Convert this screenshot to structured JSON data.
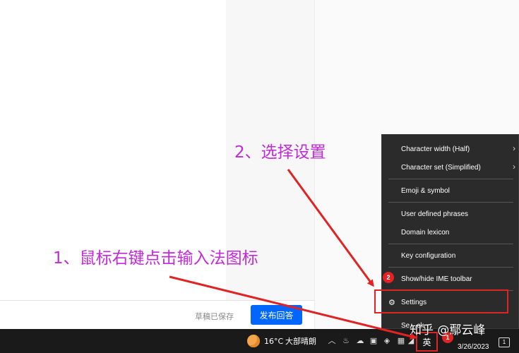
{
  "editor": {
    "draft_status": "草稿已保存",
    "publish_label": "发布回答"
  },
  "ime_menu": {
    "items": [
      {
        "label": "Character width (Half)",
        "submenu": true
      },
      {
        "label": "Character set (Simplified)",
        "submenu": true
      },
      {
        "label": "Emoji & symbol",
        "submenu": false
      },
      {
        "label": "User defined phrases",
        "submenu": false
      },
      {
        "label": "Domain lexicon",
        "submenu": false
      },
      {
        "label": "Key configuration",
        "submenu": false
      },
      {
        "label": "Show/hide IME toolbar",
        "submenu": false
      },
      {
        "label": "Settings",
        "submenu": false,
        "icon": "gear-icon"
      },
      {
        "label": "Se…ck",
        "submenu": false
      }
    ]
  },
  "taskbar": {
    "weather_temp": "16°C",
    "weather_desc": "大部晴朗",
    "ime_indicator": "英",
    "clock_time": "",
    "clock_date": "3/26/2023",
    "notification_count": "1"
  },
  "annotations": {
    "step1_text": "1、鼠标右键点击输入法图标",
    "step2_text": "2、选择设置",
    "badge1": "1",
    "badge2": "2",
    "highlight_color": "#e02323",
    "text_color": "#c22ad9"
  },
  "watermark": "知乎 @鄢云峰",
  "colors": {
    "publish_button": "#0066ff",
    "menu_bg": "#2b2b2b",
    "taskbar_bg": "#1a1a1a"
  }
}
